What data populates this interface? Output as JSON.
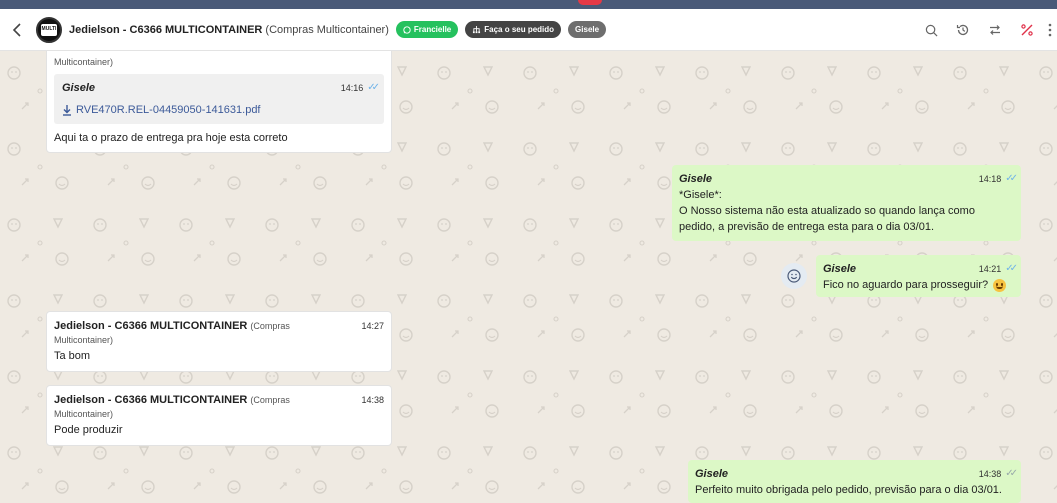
{
  "header": {
    "contact_name": "Jedielson - C6366 MULTICONTAINER",
    "contact_sub": "(Compras Multicontainer)",
    "avatar_text": "MULTI",
    "tags": [
      {
        "label": "Francielle",
        "icon": "whatsapp-icon",
        "color": "#25c15e"
      },
      {
        "label": "Faça o seu pedido",
        "icon": "sitemap-icon",
        "color": "#444444"
      },
      {
        "label": "Gisele",
        "icon": "",
        "color": "#6e6e6e"
      }
    ],
    "icons": [
      "search-icon",
      "history-icon",
      "transfer-icon",
      "percent-icon",
      "more-vertical-icon"
    ]
  },
  "messages": [
    {
      "sub_partial": "Multicontainer)",
      "quote_author": "Gisele",
      "quote_time": "14:16",
      "file_name": "RVE470R.REL-04459050-141631.pdf",
      "text": "Aqui ta o prazo de entrega pra hoje esta correto"
    },
    {
      "author": "Gisele",
      "time": "14:18",
      "lines": [
        "*Gisele*:",
        "O Nosso sistema não esta atualizado so quando lança como",
        "pedido, a previsão de entrega esta para o dia 03/01."
      ]
    },
    {
      "author": "Gisele",
      "time": "14:21",
      "text": "Fico no aguardo para prosseguir?"
    },
    {
      "author": "Jedielson - C6366 MULTICONTAINER",
      "author_sub": "(Compras",
      "sub2": "Multicontainer)",
      "time": "14:27",
      "text": "Ta bom"
    },
    {
      "author": "Jedielson - C6366 MULTICONTAINER",
      "author_sub": "(Compras",
      "sub2": "Multicontainer)",
      "time": "14:38",
      "text": "Pode produzir"
    },
    {
      "author": "Gisele",
      "time": "14:38",
      "text": "Perfeito muito obrigada pelo pedido, previsão para o dia 03/01."
    }
  ],
  "colors": {
    "outgoing_bubble": "#dcf8c6",
    "incoming_bubble": "#ffffff",
    "chat_background": "#efeae2",
    "read_ticks": "#6fb3e8"
  }
}
